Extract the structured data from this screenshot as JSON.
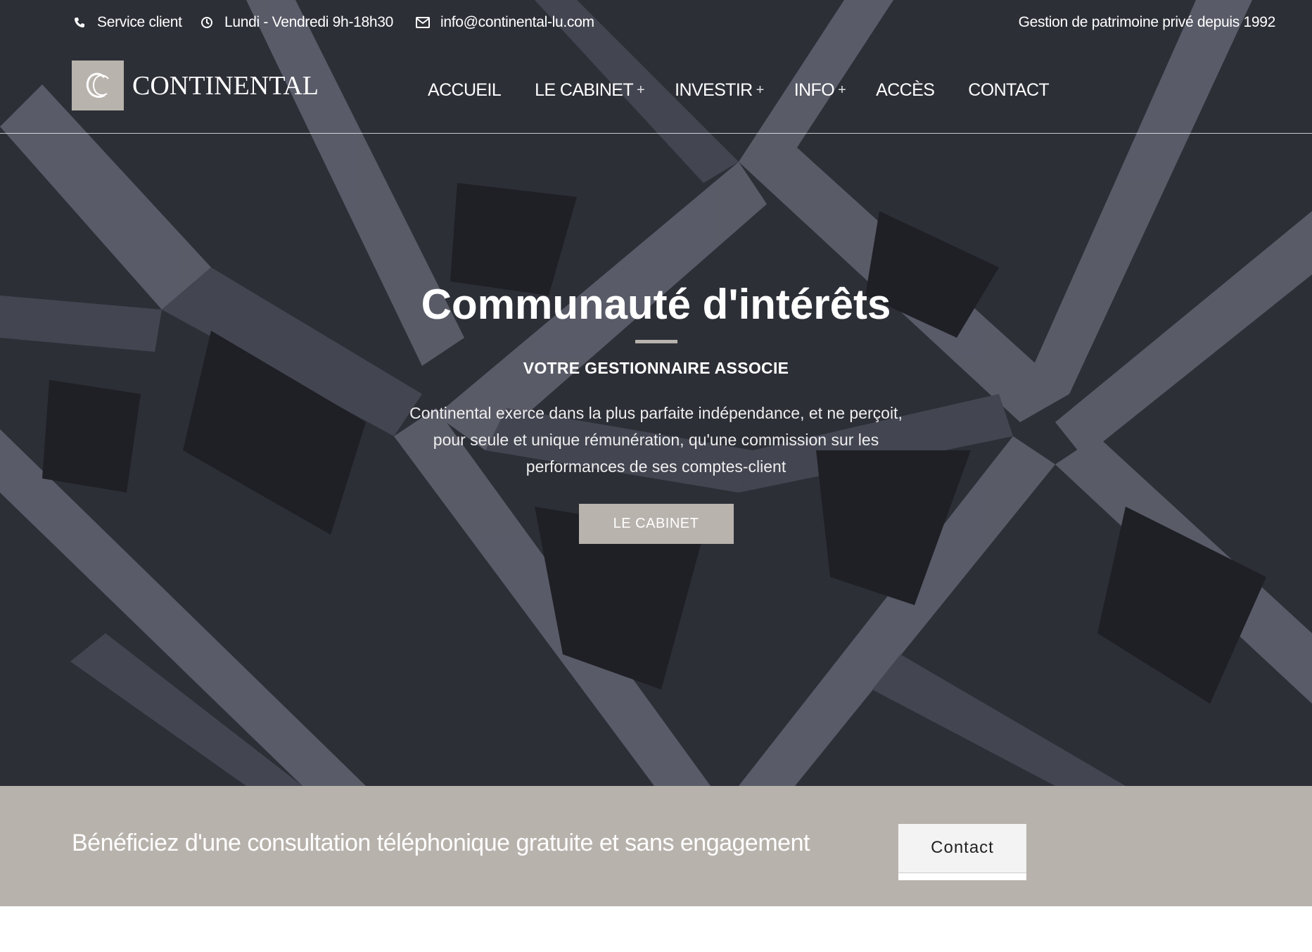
{
  "topbar": {
    "phone_label": "Service client",
    "hours_label": "Lundi - Vendredi 9h-18h30",
    "email_label": "info@continental-lu.com",
    "tagline": "Gestion de patrimoine privé depuis 1992",
    "icons": [
      "phone-icon",
      "clock-icon",
      "envelope-icon"
    ]
  },
  "logo": {
    "text": "CONTINENTAL"
  },
  "nav": {
    "items": [
      {
        "label": "ACCUEIL",
        "plus": ""
      },
      {
        "label": "LE CABINET",
        "plus": "+"
      },
      {
        "label": "INVESTIR",
        "plus": "+"
      },
      {
        "label": "INFO",
        "plus": "+"
      },
      {
        "label": "ACCÈS",
        "plus": ""
      },
      {
        "label": "CONTACT",
        "plus": ""
      }
    ]
  },
  "hero": {
    "title": "Communauté d'intérêts",
    "subtitle": "VOTRE GESTIONNAIRE ASSOCIE",
    "text": "Continental exerce dans la plus parfaite indépendance, et ne perçoit, pour seule et unique rémunération, qu'une commission sur les performances de ses comptes-client",
    "button_label": "LE CABINET"
  },
  "cta": {
    "text": "Bénéficiez d'une consultation téléphonique gratuite et sans engagement",
    "button_label": "Contact"
  },
  "colors": {
    "accent": "#b8b3ad",
    "hero_dark": "#3c3f4c",
    "text_light": "#ffffff"
  }
}
